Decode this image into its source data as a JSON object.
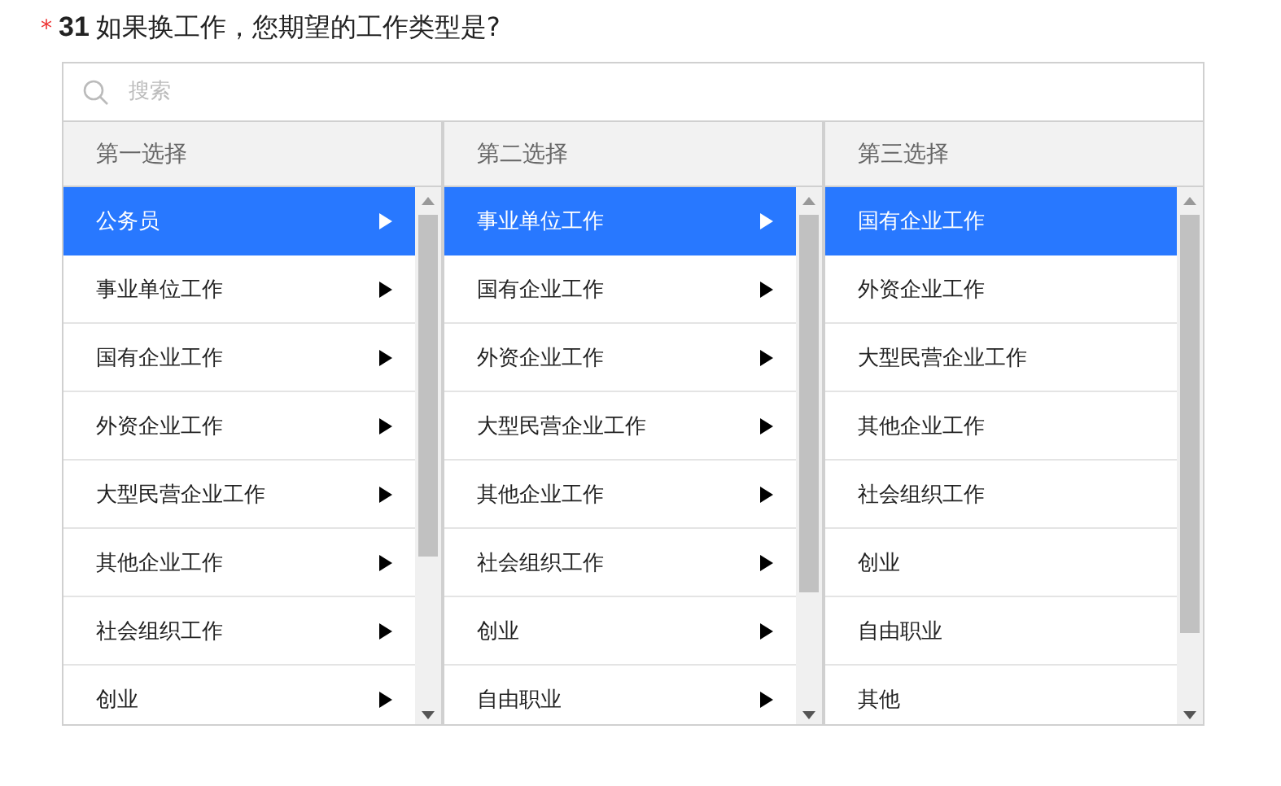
{
  "question": {
    "required_mark": "*",
    "number": "31",
    "text": "如果换工作，您期望的工作类型是?"
  },
  "search": {
    "placeholder": "搜索"
  },
  "columns": [
    {
      "header": "第一选择",
      "items": [
        {
          "label": "公务员",
          "selected": true,
          "has_children": true
        },
        {
          "label": "事业单位工作",
          "selected": false,
          "has_children": true
        },
        {
          "label": "国有企业工作",
          "selected": false,
          "has_children": true
        },
        {
          "label": "外资企业工作",
          "selected": false,
          "has_children": true
        },
        {
          "label": "大型民营企业工作",
          "selected": false,
          "has_children": true
        },
        {
          "label": "其他企业工作",
          "selected": false,
          "has_children": true
        },
        {
          "label": "社会组织工作",
          "selected": false,
          "has_children": true
        },
        {
          "label": "创业",
          "selected": false,
          "has_children": true
        }
      ]
    },
    {
      "header": "第二选择",
      "items": [
        {
          "label": "事业单位工作",
          "selected": true,
          "has_children": true
        },
        {
          "label": "国有企业工作",
          "selected": false,
          "has_children": true
        },
        {
          "label": "外资企业工作",
          "selected": false,
          "has_children": true
        },
        {
          "label": "大型民营企业工作",
          "selected": false,
          "has_children": true
        },
        {
          "label": "其他企业工作",
          "selected": false,
          "has_children": true
        },
        {
          "label": "社会组织工作",
          "selected": false,
          "has_children": true
        },
        {
          "label": "创业",
          "selected": false,
          "has_children": true
        },
        {
          "label": "自由职业",
          "selected": false,
          "has_children": true
        }
      ]
    },
    {
      "header": "第三选择",
      "items": [
        {
          "label": "国有企业工作",
          "selected": true,
          "has_children": false
        },
        {
          "label": "外资企业工作",
          "selected": false,
          "has_children": false
        },
        {
          "label": "大型民营企业工作",
          "selected": false,
          "has_children": false
        },
        {
          "label": "其他企业工作",
          "selected": false,
          "has_children": false
        },
        {
          "label": "社会组织工作",
          "selected": false,
          "has_children": false
        },
        {
          "label": "创业",
          "selected": false,
          "has_children": false
        },
        {
          "label": "自由职业",
          "selected": false,
          "has_children": false
        },
        {
          "label": "其他",
          "selected": false,
          "has_children": false
        }
      ]
    }
  ]
}
